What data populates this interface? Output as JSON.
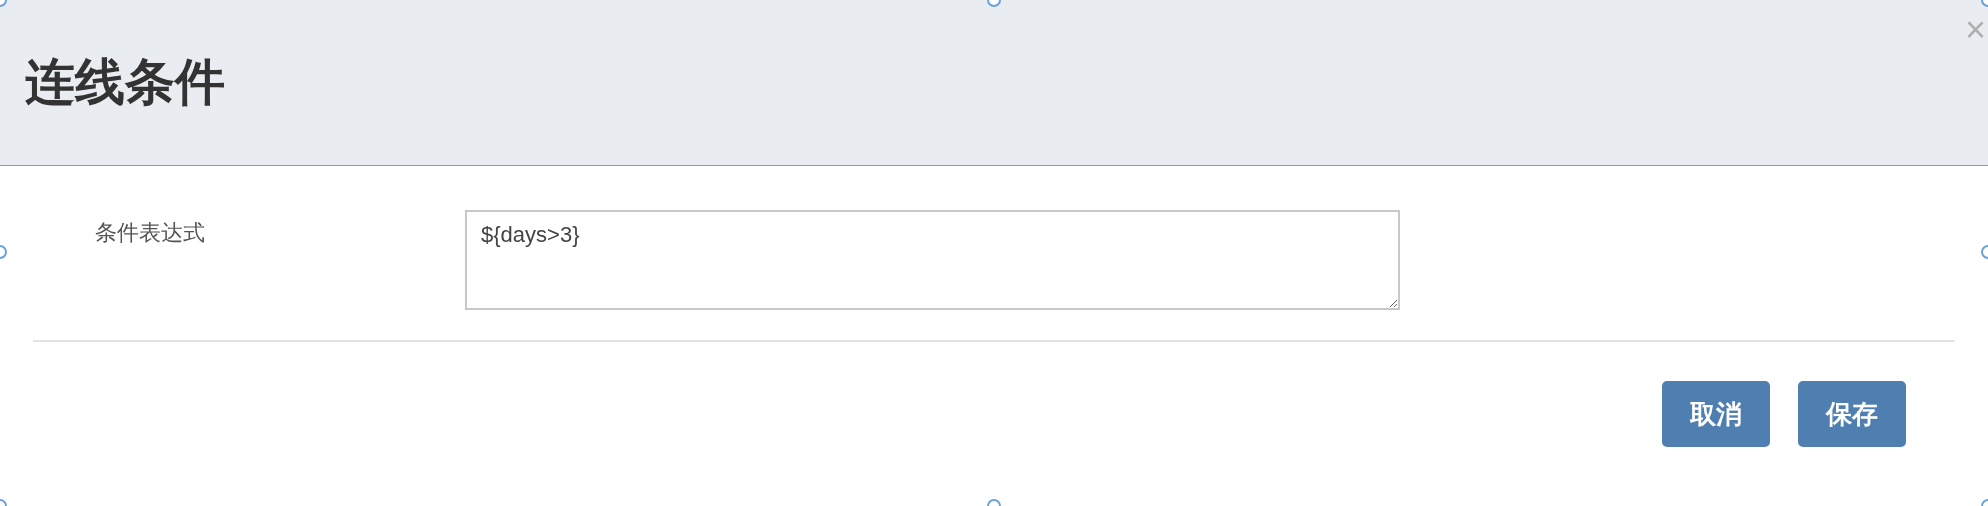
{
  "dialog": {
    "title": "连线条件",
    "close": "×"
  },
  "form": {
    "fields": [
      {
        "label": "条件表达式",
        "value": "${days>3}"
      }
    ]
  },
  "buttons": [
    {
      "label": "取消"
    },
    {
      "label": "保存"
    }
  ]
}
